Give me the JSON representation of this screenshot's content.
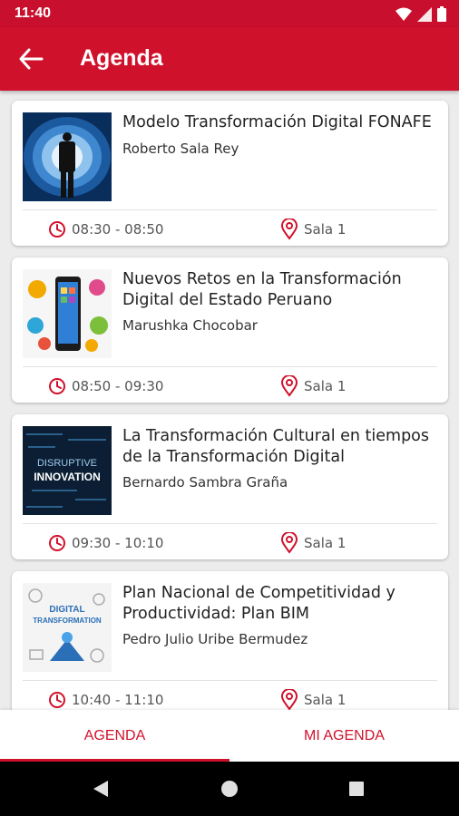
{
  "status_bar": {
    "time": "11:40"
  },
  "app_bar": {
    "title": "Agenda"
  },
  "sessions": [
    {
      "title": "Modelo Transformación Digital FONAFE",
      "speaker": "Roberto Sala Rey",
      "time": "08:30 - 08:50",
      "room": "Sala 1"
    },
    {
      "title": "Nuevos Retos en la Transformación Digital del Estado Peruano",
      "speaker": "Marushka Chocobar",
      "time": "08:50 - 09:30",
      "room": "Sala 1"
    },
    {
      "title": "La Transformación Cultural en tiempos de la Transformación Digital",
      "speaker": "Bernardo Sambra Graña",
      "time": "09:30 - 10:10",
      "room": "Sala 1"
    },
    {
      "title": "Plan Nacional de Competitividad y Productividad: Plan BIM",
      "speaker": "Pedro Julio Uribe Bermudez",
      "time": "10:40 - 11:10",
      "room": "Sala 1"
    }
  ],
  "thumbnail_text": {
    "session3_line1": "DISRUPTIVE",
    "session3_line2": "INNOVATION",
    "session4_line1": "DIGITAL",
    "session4_line2": "TRANSFORMATION"
  },
  "bottom_nav": {
    "tab_agenda": "AGENDA",
    "tab_mi_agenda": "MI AGENDA"
  },
  "colors": {
    "primary": "#d0112b",
    "status_bar": "#c8102e",
    "background": "#ececec"
  },
  "icons": {
    "back": "arrow-left-icon",
    "time": "clock-icon",
    "location": "location-pin-icon",
    "nav_back": "triangle-back-icon",
    "nav_home": "circle-home-icon",
    "nav_recents": "square-recents-icon"
  }
}
